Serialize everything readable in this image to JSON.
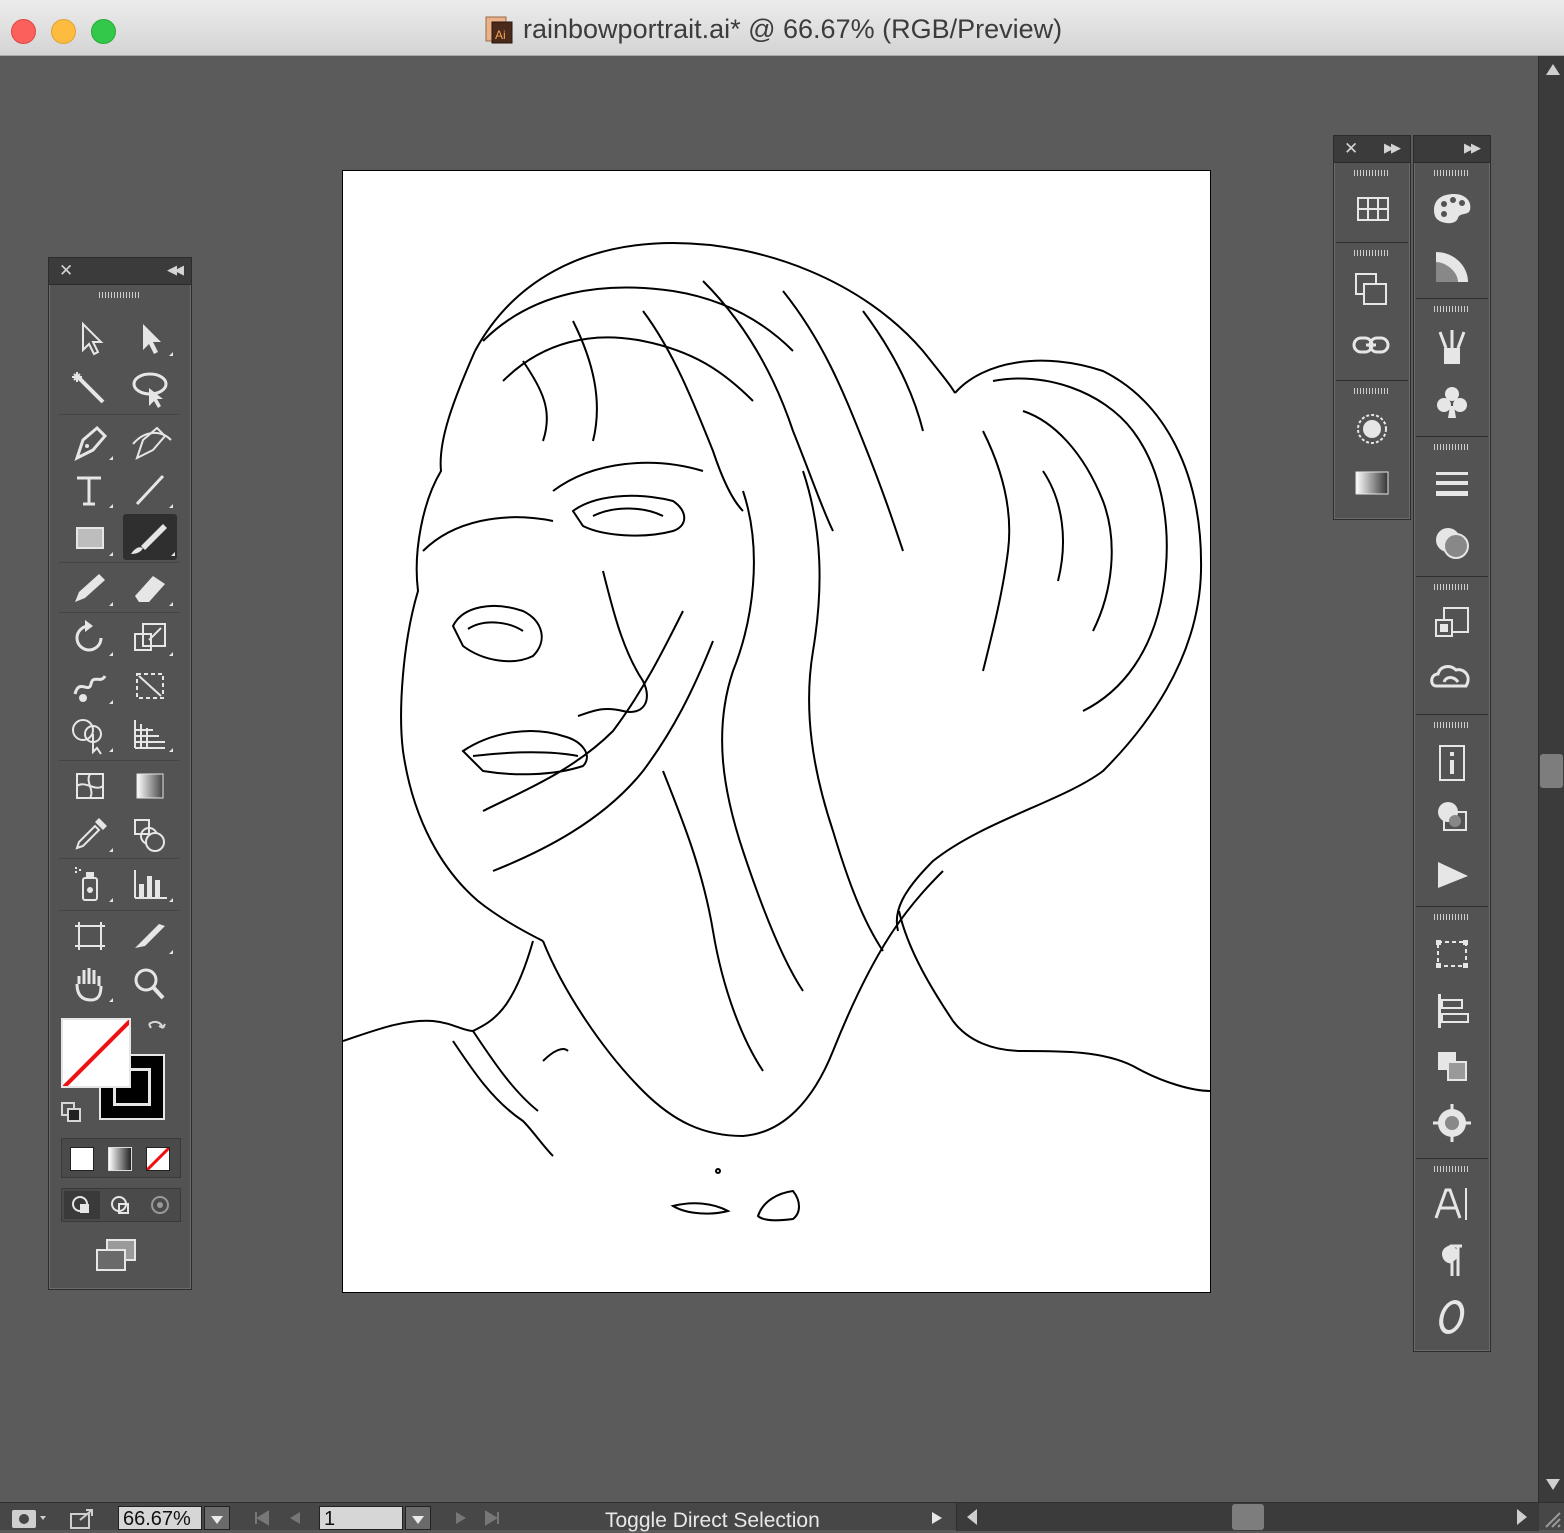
{
  "window": {
    "title": "rainbowportrait.ai* @ 66.67% (RGB/Preview)",
    "doc_icon_label": "Ai"
  },
  "tools_panel": {
    "tools": [
      "selection-tool",
      "direct-selection-tool",
      "magic-wand-tool",
      "lasso-tool",
      "pen-tool",
      "curvature-tool",
      "type-tool",
      "line-segment-tool",
      "rectangle-tool",
      "paintbrush-tool",
      "pencil-tool",
      "eraser-tool",
      "rotate-tool",
      "scale-tool",
      "warp-tool",
      "free-transform-tool",
      "shape-builder-tool",
      "perspective-grid-tool",
      "mesh-tool",
      "gradient-tool",
      "eyedropper-tool",
      "blend-tool",
      "symbol-sprayer-tool",
      "column-graph-tool",
      "artboard-tool",
      "slice-tool",
      "hand-tool",
      "zoom-tool"
    ],
    "active_tool": "paintbrush-tool",
    "fill": "none",
    "stroke": "#000000"
  },
  "right_panels": {
    "dock_a": [
      "swatches-icon",
      "transform-icon",
      "links-icon",
      "appearance-icon",
      "gradient-panel-icon"
    ],
    "dock_b": [
      "color-icon",
      "color-guide-icon",
      "brushes-icon",
      "symbols-icon",
      "stroke-icon",
      "transparency-icon",
      "navigator-icon",
      "creative-cloud-libraries-icon",
      "info-icon",
      "graphic-styles-icon",
      "actions-icon",
      "artboards-icon",
      "align-icon",
      "pathfinder-icon",
      "navigator-target-icon",
      "character-icon",
      "paragraph-icon",
      "opentype-icon"
    ]
  },
  "status": {
    "zoom": "66.67%",
    "artboard_number": "1",
    "message": "Toggle Direct Selection"
  },
  "colors": {
    "workspace": "#5b5b5b",
    "panel": "#535353",
    "artboard": "#ffffff"
  }
}
